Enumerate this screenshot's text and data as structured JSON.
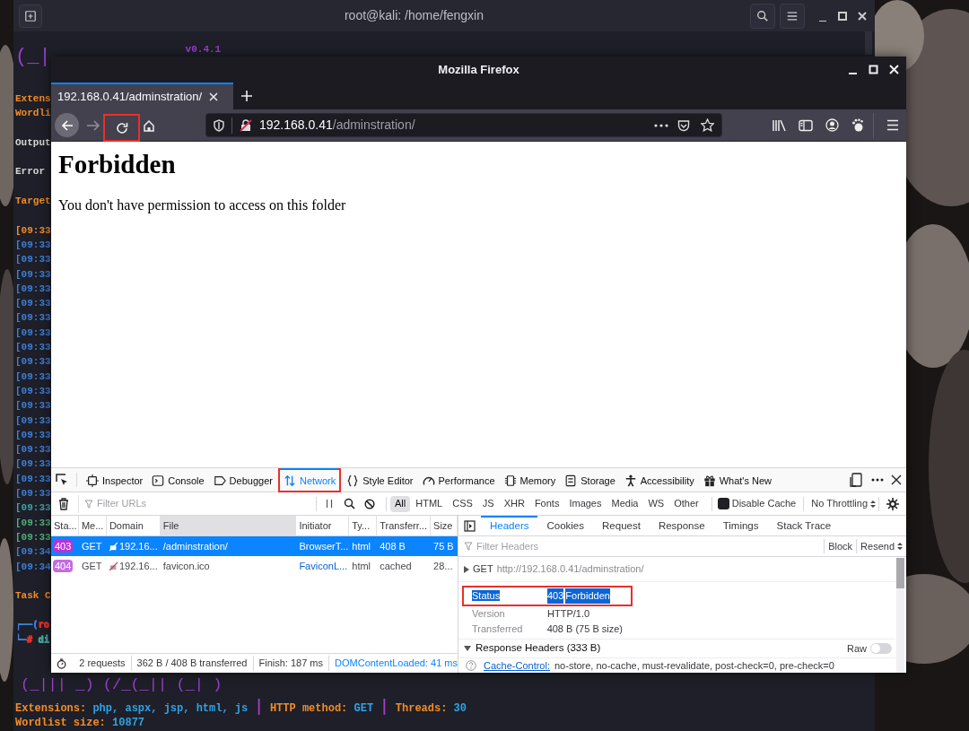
{
  "terminal": {
    "title": "root@kali: /home/fengxin",
    "banner_top": "(_|",
    "version": "v0.4.1",
    "blocks": [
      [
        {
          "text": "Extens",
          "color": "#f28c28"
        },
        {
          "text": "Wordli",
          "color": "#f28c28"
        }
      ],
      [
        {
          "text": "Output",
          "color": "#d6d6d6"
        }
      ],
      [
        {
          "text": "Error",
          "color": "#d6d6d6"
        }
      ],
      [
        {
          "text": "Target",
          "color": "#f28c28"
        }
      ],
      [
        {
          "text": "[09:33",
          "color": "#f28c28"
        },
        {
          "text": "[09:33",
          "color": "#3d7fd8"
        },
        {
          "text": "[09:33",
          "color": "#3d7fd8"
        },
        {
          "text": "[09:33",
          "color": "#3d7fd8"
        },
        {
          "text": "[09:33",
          "color": "#3d7fd8"
        },
        {
          "text": "[09:33",
          "color": "#3d7fd8"
        },
        {
          "text": "[09:33",
          "color": "#3d7fd8"
        },
        {
          "text": "[09:33",
          "color": "#3d7fd8"
        },
        {
          "text": "[09:33",
          "color": "#3d7fd8"
        },
        {
          "text": "[09:33",
          "color": "#3d7fd8"
        },
        {
          "text": "[09:33",
          "color": "#3d7fd8"
        },
        {
          "text": "[09:33",
          "color": "#3d7fd8"
        },
        {
          "text": "[09:33",
          "color": "#3d7fd8"
        },
        {
          "text": "[09:33",
          "color": "#3d7fd8"
        },
        {
          "text": "[09:33",
          "color": "#3d7fd8"
        },
        {
          "text": "[09:33",
          "color": "#3d7fd8"
        },
        {
          "text": "[09:33",
          "color": "#3d7fd8"
        },
        {
          "text": "[09:33",
          "color": "#3d7fd8"
        },
        {
          "text": "[09:33",
          "color": "#3d7fd8"
        },
        {
          "text": "[09:33",
          "color": "#3fa0a8"
        },
        {
          "text": "[09:33",
          "color": "#4caf78"
        },
        {
          "text": "[09:33",
          "color": "#4caf78"
        },
        {
          "text": "[09:34",
          "color": "#3d7fd8"
        },
        {
          "text": "[09:34",
          "color": "#3d7fd8"
        }
      ],
      [
        {
          "text": "Task C",
          "color": "#f28c28"
        }
      ]
    ],
    "prompt": [
      [
        {
          "text": "┌──(",
          "color": "#3d7fd8"
        },
        {
          "text": "ro",
          "color": "#e0302a"
        }
      ],
      [
        {
          "text": "└─",
          "color": "#3d7fd8"
        },
        {
          "text": "#",
          "color": "#e0302a"
        },
        {
          "text": " di",
          "color": "#4aa3a0"
        }
      ]
    ],
    "banner_bottom": "(_||| _) (/_(_|| (_| )",
    "summary": [
      [
        {
          "text": "Extensions: ",
          "color": "#f28c28"
        },
        {
          "text": "php, aspx, jsp, html, js ",
          "color": "#2fa3e6"
        },
        {
          "text": "|",
          "color": "#a43cc8",
          "kind": "separator"
        },
        {
          "text": " HTTP method: ",
          "color": "#f28c28"
        },
        {
          "text": "GET ",
          "color": "#2fa3e6"
        },
        {
          "text": "|",
          "color": "#a43cc8",
          "kind": "separator"
        },
        {
          "text": " Threads: ",
          "color": "#f28c28"
        },
        {
          "text": "30",
          "color": "#2fa3e6"
        }
      ],
      [
        {
          "text": "Wordlist size: ",
          "color": "#f28c28"
        },
        {
          "text": "10877",
          "color": "#2fa3e6"
        }
      ]
    ]
  },
  "firefox": {
    "title": "Mozilla Firefox",
    "tabs": [
      {
        "label": "192.168.0.41/adminstration/",
        "selected": true
      }
    ],
    "reload": {
      "annotated": true
    },
    "url": {
      "host": "192.168.0.41",
      "path": "/adminstration/"
    },
    "page": {
      "heading": "Forbidden",
      "text": "You don't have permission to access on this folder"
    },
    "devtools": {
      "tools": [
        {
          "label": "Inspector",
          "selected": false,
          "annotated": false
        },
        {
          "label": "Console",
          "selected": false,
          "annotated": false
        },
        {
          "label": "Debugger",
          "selected": false,
          "annotated": false
        },
        {
          "label": "Network",
          "selected": true,
          "annotated": true
        },
        {
          "label": "Style Editor",
          "selected": false,
          "annotated": false
        },
        {
          "label": "Performance",
          "selected": false,
          "annotated": false
        },
        {
          "label": "Memory",
          "selected": false,
          "annotated": false
        },
        {
          "label": "Storage",
          "selected": false,
          "annotated": false
        },
        {
          "label": "Accessibility",
          "selected": false,
          "annotated": false
        },
        {
          "label": "What's New",
          "selected": false,
          "annotated": false
        }
      ],
      "filter_placeholder": "Filter URLs",
      "type_filters": [
        {
          "label": "All",
          "selected": true
        },
        {
          "label": "HTML",
          "selected": false
        },
        {
          "label": "CSS",
          "selected": false
        },
        {
          "label": "JS",
          "selected": false
        },
        {
          "label": "XHR",
          "selected": false
        },
        {
          "label": "Fonts",
          "selected": false
        },
        {
          "label": "Images",
          "selected": false
        },
        {
          "label": "Media",
          "selected": false
        },
        {
          "label": "WS",
          "selected": false
        },
        {
          "label": "Other",
          "selected": false
        }
      ],
      "disable_cache": {
        "label": "Disable Cache",
        "checked": true
      },
      "throttling": "No Throttling",
      "columns": [
        {
          "label": "Sta...",
          "sorted": false
        },
        {
          "label": "Me...",
          "sorted": false
        },
        {
          "label": "Domain",
          "sorted": false
        },
        {
          "label": "File",
          "sorted": true
        },
        {
          "label": "Initiator",
          "sorted": false
        },
        {
          "label": "Ty...",
          "sorted": false
        },
        {
          "label": "Transferr...",
          "sorted": false
        },
        {
          "label": "Size",
          "sorted": false
        }
      ],
      "requests": [
        {
          "status": "403",
          "color": "#b833d6",
          "method": "GET",
          "domain": "192.16...",
          "file": "/adminstration/",
          "initiator": "BrowserT...",
          "type": "html",
          "transferred": "408 B",
          "size": "75 B",
          "selected": true
        },
        {
          "status": "404",
          "color": "#c46be0",
          "method": "GET",
          "domain": "192.16...",
          "file": "favicon.ico",
          "initiator": "FaviconL...",
          "type": "html",
          "transferred": "cached",
          "size": "28...",
          "selected": false
        }
      ],
      "summary": [
        "2 requests",
        "362 B / 408 B transferred",
        "Finish: 187 ms"
      ],
      "dom_loaded": "DOMContentLoaded: 41 ms",
      "details": {
        "tabs": [
          {
            "label": "Headers",
            "selected": true
          },
          {
            "label": "Cookies",
            "selected": false
          },
          {
            "label": "Request",
            "selected": false
          },
          {
            "label": "Response",
            "selected": false
          },
          {
            "label": "Timings",
            "selected": false
          },
          {
            "label": "Stack Trace",
            "selected": false
          }
        ],
        "filter_placeholder": "Filter Headers",
        "block": "Block",
        "resend": "Resend",
        "request": {
          "method": "GET",
          "url": "http://192.168.0.41/adminstration/"
        },
        "fields": [
          {
            "kind": "status",
            "label": "Status",
            "code": "403",
            "text": "Forbidden",
            "selected": true,
            "annotated": true
          },
          {
            "kind": "plain",
            "label": "Version",
            "value": "HTTP/1.0",
            "selected": false,
            "annotated": false
          },
          {
            "kind": "plain",
            "label": "Transferred",
            "value": "408 B (75 B size)",
            "selected": false,
            "annotated": false
          }
        ],
        "response_headers": {
          "title": "Response Headers (333 B)",
          "expanded": true,
          "raw_label": "Raw",
          "raw": false
        },
        "headers": [
          {
            "name": "Cache-Control:",
            "value": "no-store, no-cache, must-revalidate, post-check=0, pre-check=0"
          }
        ]
      }
    }
  }
}
